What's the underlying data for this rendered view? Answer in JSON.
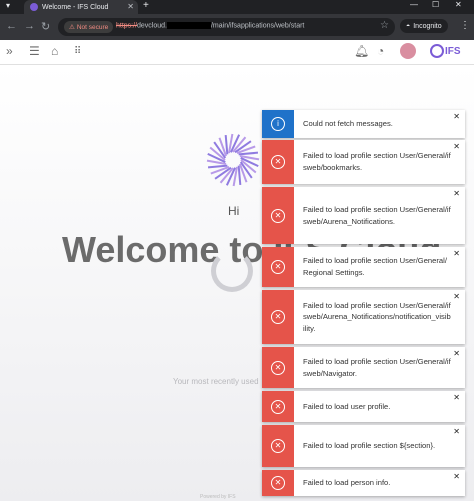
{
  "browser": {
    "tab_title": "Welcome - IFS Cloud",
    "not_secure_label": "Not secure",
    "url_protocol": "https://",
    "url_host_visible": "devcloud.",
    "url_path": "/main/ifsapplications/web/start",
    "incognito_label": "Incognito"
  },
  "page": {
    "logo_text": "IFS",
    "greeting": "Hi",
    "welcome_heading": "Welcome to IFS Cloud",
    "recent_text": "Your most recently used",
    "footer_text": "Powered by IFS"
  },
  "colors": {
    "error_red": "#e5544a",
    "info_blue": "#1f72c9",
    "ifs_purple": "#7b5cd6"
  },
  "toasts": [
    {
      "type": "info",
      "message": "Could not fetch messages."
    },
    {
      "type": "error",
      "message": "Failed to load profile section User/General/ifsweb/bookmarks."
    },
    {
      "type": "error",
      "message": "Failed to load profile section User/General/ifsweb/Aurena_Notifications."
    },
    {
      "type": "error",
      "message": "Failed to load profile section User/General/Regional Settings."
    },
    {
      "type": "error",
      "message": "Failed to load profile section User/General/ifsweb/Aurena_Notifications/notification_visibility."
    },
    {
      "type": "error",
      "message": "Failed to load profile section User/General/ifsweb/Navigator."
    },
    {
      "type": "error",
      "message": "Failed to load user profile."
    },
    {
      "type": "error",
      "message": "Failed to load profile section ${section}."
    },
    {
      "type": "error",
      "message": "Failed to load person info."
    }
  ]
}
